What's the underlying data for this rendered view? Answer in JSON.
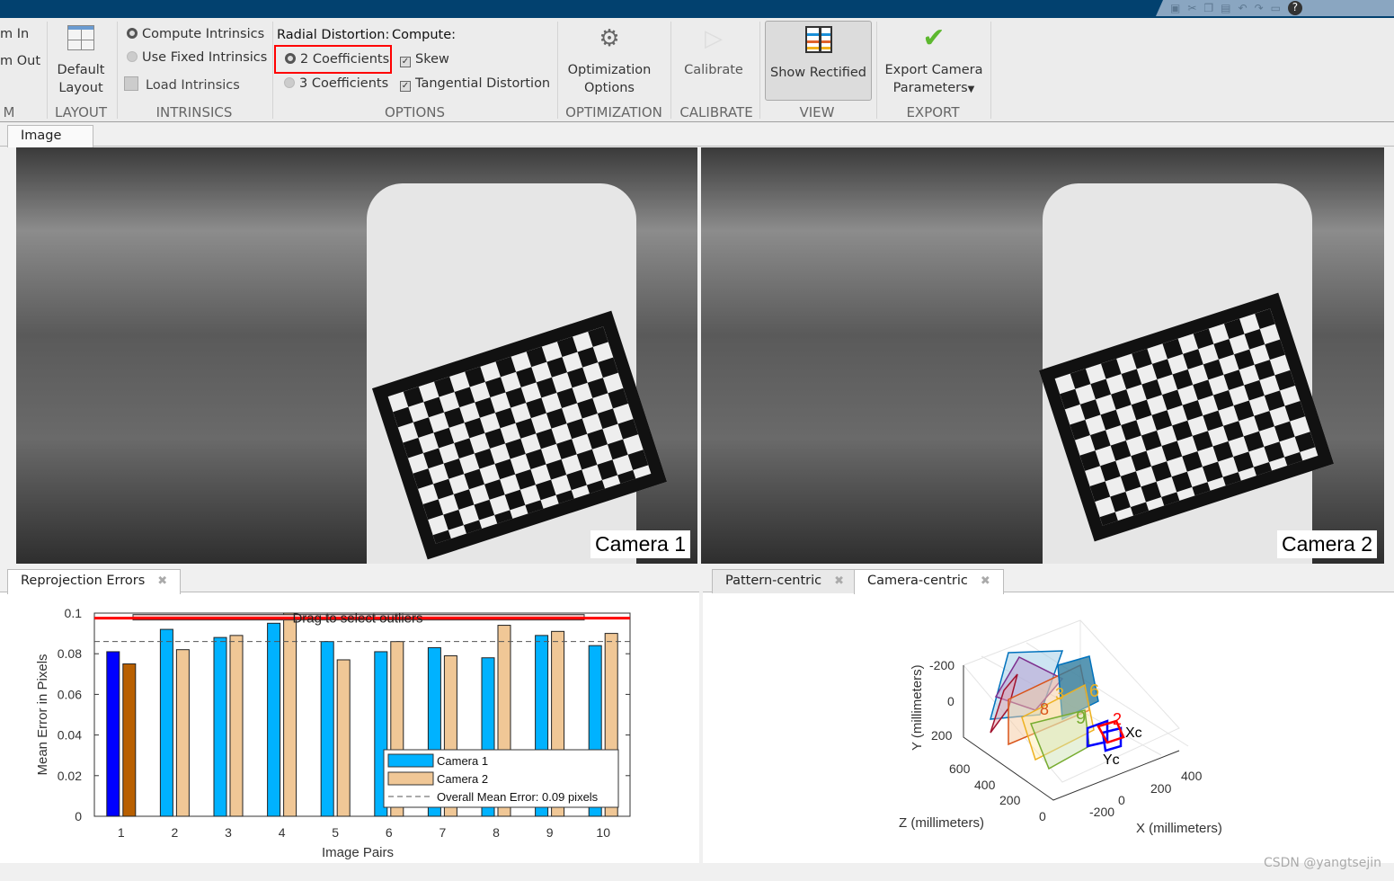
{
  "toolbar": {
    "zoom_in": "m In",
    "zoom_out": "m Out",
    "zoom_section": "M",
    "default_layout": "Default Layout",
    "layout_section": "LAYOUT",
    "compute_intrinsics": "Compute Intrinsics",
    "use_fixed_intrinsics": "Use Fixed Intrinsics",
    "load_intrinsics": "Load Intrinsics",
    "intrinsics_section": "INTRINSICS",
    "radial_label": "Radial Distortion:",
    "compute_label": "Compute:",
    "two_coeff": "2 Coefficients",
    "three_coeff": "3 Coefficients",
    "skew": "Skew",
    "tangential": "Tangential Distortion",
    "options_section": "OPTIONS",
    "optimization_options": "Optimization Options",
    "optimization_section": "OPTIMIZATION",
    "calibrate": "Calibrate",
    "calibrate_section": "CALIBRATE",
    "show_rectified": "Show Rectified",
    "view_section": "VIEW",
    "export_line1": "Export Camera",
    "export_line2": "Parameters",
    "export_section": "EXPORT",
    "selected_radial": "2 Coefficients",
    "skew_checked": true,
    "tangential_checked": true,
    "intrinsics_mode": "Compute Intrinsics"
  },
  "image_tab": "Image",
  "images": {
    "left_label": "Camera 1",
    "right_label": "Camera 2"
  },
  "bottom_left": {
    "tab": "Reprojection Errors"
  },
  "bottom_right": {
    "tabs": [
      "Pattern-centric",
      "Camera-centric"
    ],
    "active": "Camera-centric"
  },
  "chart_data": [
    {
      "type": "bar",
      "categories": [
        "1",
        "2",
        "3",
        "4",
        "5",
        "6",
        "7",
        "8",
        "9",
        "10"
      ],
      "series": [
        {
          "name": "Camera 1",
          "values": [
            0.081,
            0.092,
            0.088,
            0.095,
            0.086,
            0.081,
            0.083,
            0.078,
            0.089,
            0.084
          ],
          "color": "#00b2ff",
          "selected_color": "#0000ff"
        },
        {
          "name": "Camera 2",
          "values": [
            0.075,
            0.082,
            0.089,
            0.1,
            0.077,
            0.086,
            0.079,
            0.094,
            0.091,
            0.09
          ],
          "color": "#f0c796",
          "selected_color": "#b85f00"
        }
      ],
      "selected_category": "1",
      "overall_mean": {
        "label": "Overall Mean Error: 0.09 pixels",
        "value": 0.086
      },
      "threshold": {
        "label": "Drag to select outliers",
        "value": 0.0975,
        "color": "#ff0000"
      },
      "xlabel": "Image Pairs",
      "ylabel": "Mean Error in Pixels",
      "ylim": [
        0,
        0.1
      ],
      "yticks": [
        "0",
        "0.02",
        "0.04",
        "0.06",
        "0.08",
        "0.1"
      ],
      "legend": "bottom-right"
    },
    {
      "type": "3d-extrinsics",
      "xlabel": "X (millimeters)",
      "ylabel": "Y (millimeters)",
      "zlabel": "Z (millimeters)",
      "xticks": [
        "-200",
        "0",
        "200",
        "400"
      ],
      "yticks": [
        "-200",
        "0",
        "200"
      ],
      "zticks": [
        "0",
        "200",
        "400",
        "600"
      ],
      "pattern_labels": [
        "1",
        "2",
        "3",
        "4",
        "5",
        "6",
        "7",
        "8",
        "9",
        "10"
      ],
      "camera_axes": [
        "Xc",
        "Yc"
      ],
      "camera_labels": [
        "1",
        "2"
      ]
    }
  ],
  "watermark": "CSDN @yangtsejin"
}
